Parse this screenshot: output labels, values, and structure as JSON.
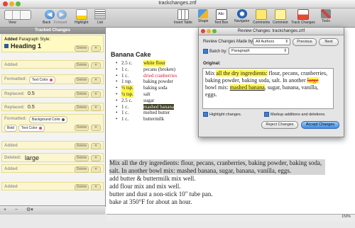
{
  "window": {
    "title": "trackchanges.zrtf"
  },
  "toolbar": {
    "view": "View",
    "back": "Back",
    "forward": "Forward",
    "highlight": "Highlight",
    "list": "List",
    "insert_table": "Insert Table",
    "shape": "Shape",
    "text_box": "Text Box",
    "navigator": "Navigator",
    "comments": "Comments",
    "comment": "Comment",
    "track_changes": "Track Changes",
    "tools": "Tools"
  },
  "sidebar": {
    "header": "Tracked Changes",
    "delete_label": "Delete",
    "reject_symbol": "✕",
    "cards": [
      {
        "label": "Added",
        "extra_prefix": "Paragraph Style:",
        "value": "Heading 1"
      },
      {
        "label": "Added"
      },
      {
        "label": "Formatted:",
        "pill": "Text Color"
      },
      {
        "label": "Replaced:",
        "value": "0.5"
      },
      {
        "label": "Replaced:",
        "value": "0.5"
      },
      {
        "label": "Formatted:",
        "pill": "Background Color",
        "pill2": "Bold",
        "pill3": "Text Color"
      },
      {
        "label": "Added"
      },
      {
        "label": "Deleted:",
        "value": "large"
      },
      {
        "label": "Added"
      },
      {
        "label": "Added"
      }
    ],
    "bottom": {
      "add": "+",
      "remove": "−",
      "menu": "⚙▾"
    }
  },
  "document": {
    "title": "Banana Cake",
    "ingredients": [
      {
        "qty": "2.5 c.",
        "name": "white flour"
      },
      {
        "qty": "1 c.",
        "name": "pecans (broken)"
      },
      {
        "qty": "1 c.",
        "name": "dried cranberries"
      },
      {
        "qty": "1 tsp.",
        "name": "baking powder"
      },
      {
        "qty": "½ tsp.",
        "name": "baking soda"
      },
      {
        "qty": "¼ tsp.",
        "name": "salt"
      },
      {
        "qty": "2.5 c.",
        "name": "sugar"
      },
      {
        "qty": "1 c.",
        "name": "mashed banana"
      },
      {
        "qty": "1 c.",
        "name": "melted butter"
      },
      {
        "qty": "1 c.",
        "name": "buttermilk"
      }
    ],
    "method_selected": "Mix all the dry ingredients: flour, pecans, cranberries, baking powder, baking soda, salt. In another bowl mix: mashed banana, sugar, banana, vanilla, eggs.",
    "method_lines": [
      "add butter & buttermilk mix well.",
      "add flour mix and mix well.",
      "butter and dust a non-stick 10\" tube pan.",
      "bake at 350°F for about an hour."
    ]
  },
  "dialog": {
    "title": "Review Changes: trackchanges.zrtf",
    "made_by_label": "Review Changes Made by:",
    "made_by_value": "All Authors",
    "previous": "Previous",
    "next": "Next",
    "batch_label": "Batch by:",
    "batch_value": "Paragraph",
    "original_label": "Original:",
    "original_parts": [
      "Mix ",
      "all the dry ingredients:",
      " flour, pecans, cranberries, baking powder, baking soda, salt. In another ",
      "large",
      " bowl mix: ",
      "mashed banana",
      ", sugar, banana, vanilla, eggs."
    ],
    "highlight_changes": "Highlight changes.",
    "markup_label": "Markup additions and deletions.",
    "reject": "Reject Changes",
    "accept": "Accept Changes"
  },
  "statusbar": {
    "zoom": "150%"
  },
  "colors": {
    "accent": "#3d8ce6",
    "card": "#fff9c2",
    "highlight": "#fff64a",
    "deletion": "#d61c1c"
  }
}
